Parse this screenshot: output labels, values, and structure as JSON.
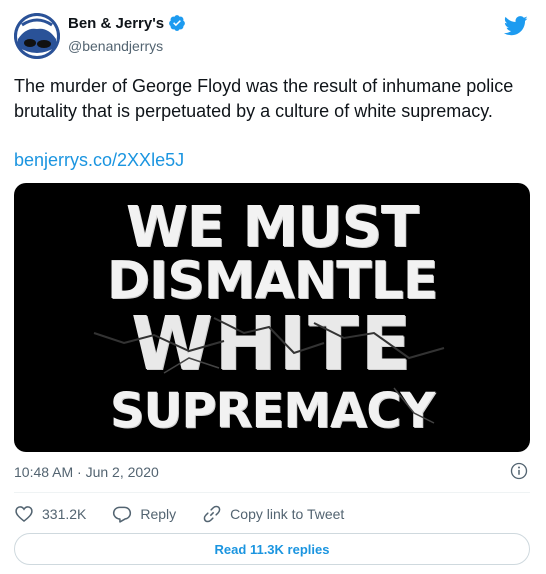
{
  "author": {
    "display_name": "Ben & Jerry's",
    "handle": "@benandjerrys",
    "verified": true,
    "avatar_icon": "ben-and-jerrys-logo"
  },
  "tweet": {
    "text": "The murder of George Floyd was the result of inhumane police brutality that is perpetuated by a culture of white supremacy.",
    "link": "benjerrys.co/2XXle5J",
    "image_lines": [
      "WE MUST",
      "DISMANTLE",
      "WHITE",
      "SUPREMACY"
    ],
    "timestamp": "10:48 AM · Jun 2, 2020"
  },
  "actions": {
    "likes": "331.2K",
    "reply_label": "Reply",
    "copy_link_label": "Copy link to Tweet"
  },
  "replies_button": "Read 11.3K replies",
  "colors": {
    "accent": "#1b95e0",
    "muted": "#536471",
    "media_bg": "#000000"
  }
}
